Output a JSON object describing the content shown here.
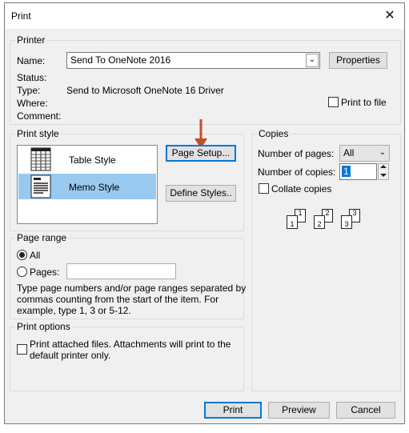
{
  "window": {
    "title": "Print",
    "close_label": "✕"
  },
  "printer": {
    "group_label": "Printer",
    "name_label": "Name:",
    "name_value": "Send To OneNote 2016",
    "properties_button": "Properties",
    "status_label": "Status:",
    "status_value": "",
    "type_label": "Type:",
    "type_value": "Send to Microsoft OneNote 16 Driver",
    "where_label": "Where:",
    "where_value": "",
    "comment_label": "Comment:",
    "comment_value": "",
    "print_to_file_label": "Print to file",
    "print_to_file_checked": false
  },
  "print_style": {
    "group_label": "Print style",
    "styles": [
      {
        "label": "Table Style",
        "icon": "table-style-icon",
        "selected": false
      },
      {
        "label": "Memo Style",
        "icon": "memo-style-icon",
        "selected": true
      }
    ],
    "page_setup_button": "Page Setup...",
    "define_styles_button": "Define Styles.."
  },
  "copies": {
    "group_label": "Copies",
    "number_of_pages_label": "Number of pages:",
    "number_of_pages_value": "All",
    "number_of_copies_label": "Number of copies:",
    "number_of_copies_value": "1",
    "collate_label": "Collate copies",
    "collate_checked": false,
    "collate_preview": [
      {
        "back": "1",
        "front": "1"
      },
      {
        "back": "2",
        "front": "2"
      },
      {
        "back": "3",
        "front": "3"
      }
    ]
  },
  "page_range": {
    "group_label": "Page range",
    "all_label": "All",
    "all_selected": true,
    "pages_label": "Pages:",
    "pages_value": "",
    "help_line1": "Type page numbers and/or page ranges separated by",
    "help_line2": "commas counting from the start of the item.  For",
    "help_line3": "example, type 1, 3 or 5-12."
  },
  "print_options": {
    "group_label": "Print options",
    "attached_line1": "Print attached files.  Attachments will print to the",
    "attached_line2": "default printer only.",
    "attached_checked": false
  },
  "footer": {
    "print_button": "Print",
    "preview_button": "Preview",
    "cancel_button": "Cancel"
  },
  "colors": {
    "accent": "#0078d7",
    "arrow": "#c0502a",
    "selection": "#99c9ef"
  }
}
